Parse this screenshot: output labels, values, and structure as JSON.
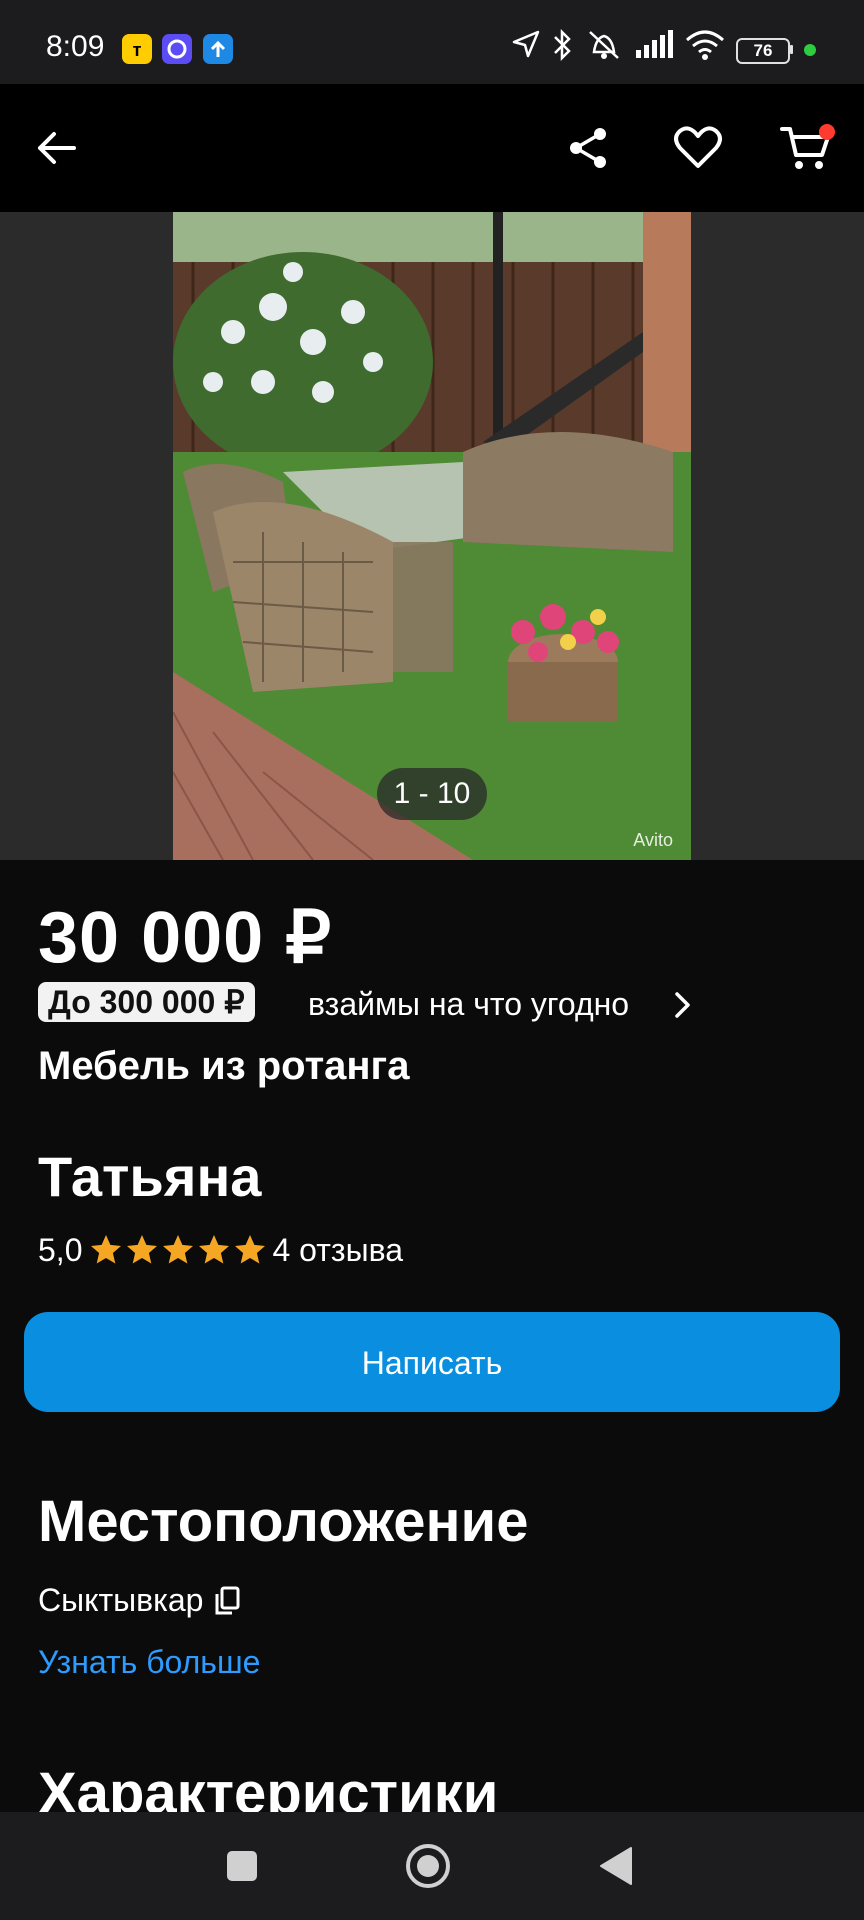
{
  "status_bar": {
    "time": "8:09",
    "battery": "76",
    "icons": [
      "yandex-taxi-app-icon",
      "messenger-app-icon",
      "upload-app-icon",
      "location-icon",
      "bluetooth-icon",
      "alarm-off-icon",
      "signal-icon",
      "wifi-icon",
      "battery-icon"
    ]
  },
  "app_bar": {
    "icons": [
      "back-arrow-icon",
      "share-icon",
      "heart-icon",
      "cart-icon"
    ],
    "accent": "#ff3b30"
  },
  "gallery": {
    "counter": "1 - 10",
    "watermark": "Avito"
  },
  "listing": {
    "price": "30 000 ₽",
    "loan_badge": "До 300 000 ₽",
    "loan_text": "взаймы на что угодно",
    "title": "Мебель из ротанга"
  },
  "seller": {
    "name": "Татьяна",
    "rating": "5,0",
    "stars": 5,
    "reviews": "4 отзыва",
    "star_color": "#f5a623"
  },
  "actions": {
    "write_label": "Написать",
    "button_color": "#0a8fe0"
  },
  "location": {
    "heading": "Местоположение",
    "city": "Сыктывкар",
    "learn_more": "Узнать больше"
  },
  "characteristics": {
    "heading": "Характеристики"
  },
  "nav_bar": {
    "icons": [
      "recents-square-icon",
      "home-circle-icon",
      "back-triangle-icon"
    ]
  }
}
